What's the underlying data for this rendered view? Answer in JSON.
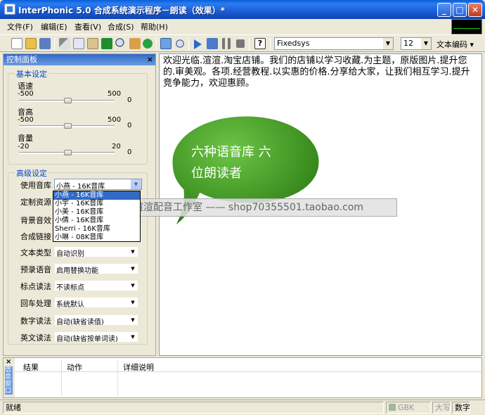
{
  "window": {
    "title": "InterPhonic 5.0 合成系统演示程序－朗读（效果）*"
  },
  "menu": [
    "文件(F)",
    "编辑(E)",
    "查看(V)",
    "合成(S)",
    "帮助(H)"
  ],
  "toolbar": {
    "font": "Fixedsys",
    "size": "12",
    "encoding_label": "文本编码"
  },
  "panel": {
    "title": "控制面板",
    "basic": {
      "label": "基本设定",
      "speed": {
        "label": "语速",
        "min": "-500",
        "max": "500",
        "value": "0",
        "fraction": 0.5
      },
      "pitch": {
        "label": "音高",
        "min": "-500",
        "max": "500",
        "value": "0",
        "fraction": 0.5
      },
      "volume": {
        "label": "音量",
        "min": "-20",
        "max": "20",
        "value": "0",
        "fraction": 0.5
      }
    },
    "advanced": {
      "label": "高级设定",
      "rows": [
        {
          "label": "使用音库",
          "value": "小燕 - 16K音库"
        },
        {
          "label": "定制资源",
          "value": ""
        },
        {
          "label": "背景音效",
          "value": ""
        },
        {
          "label": "合成链接",
          "value": ""
        },
        {
          "label": "文本类型",
          "value": "自动识别"
        },
        {
          "label": "预录语音",
          "value": "启用替换功能"
        },
        {
          "label": "标点读法",
          "value": "不读标点"
        },
        {
          "label": "回车处理",
          "value": "系统默认"
        },
        {
          "label": "数字读法",
          "value": "自动(缺省读值)"
        },
        {
          "label": "英文读法",
          "value": "自动(缺省按单词读)"
        }
      ],
      "voice_options": [
        "小燕 - 16K音库",
        "小宇 - 16K音库",
        "小美 - 16K音库",
        "小倩 - 16K音库",
        "Sherri - 16K音库",
        "小琳 - 08K音库"
      ]
    }
  },
  "editor": {
    "text": "欢迎光临.渲渲.淘宝店铺。我们的店铺以学习收藏.为主题，原版图片.提升您的.审美观。各项.经营教程.以实惠的价格.分享给大家，让我们相互学习.提升竞争能力，欢迎惠顾。"
  },
  "balloon": {
    "line1": "六种语音库  六",
    "line2": "位朗读者"
  },
  "watermark": {
    "text": "渲渲配音工作室 —— shop70355501.taobao.com"
  },
  "results": {
    "side_label": "信息窗口",
    "col1": "结果",
    "col2": "动作",
    "col3": "详细说明"
  },
  "status": {
    "text": "就绪",
    "gbk": "GBK",
    "caps": "大写",
    "num": "数字"
  },
  "colors": {
    "balloon": "#3d9a1f",
    "selection": "#316AC5",
    "title": "#0A5FD8"
  }
}
